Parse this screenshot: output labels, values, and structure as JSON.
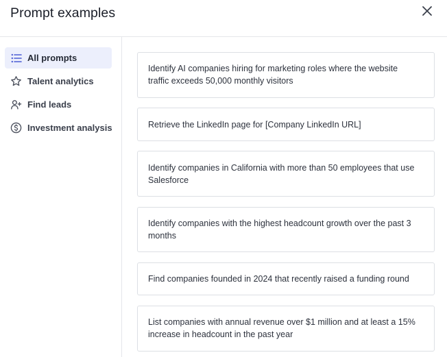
{
  "modal": {
    "title": "Prompt examples",
    "close_icon": "close-icon"
  },
  "sidebar": {
    "items": [
      {
        "label": "All prompts",
        "icon": "list-icon",
        "active": true
      },
      {
        "label": "Talent analytics",
        "icon": "star-icon",
        "active": false
      },
      {
        "label": "Find leads",
        "icon": "user-plus-icon",
        "active": false
      },
      {
        "label": "Investment analysis",
        "icon": "dollar-circle-icon",
        "active": false
      }
    ]
  },
  "prompts": [
    {
      "text": "Identify AI companies hiring for marketing roles where the website traffic exceeds 50,000 monthly visitors"
    },
    {
      "text": "Retrieve the LinkedIn page for [Company LinkedIn URL]"
    },
    {
      "text": "Identify companies in California with more than 50 employees that use Salesforce"
    },
    {
      "text": "Identify companies with the highest headcount growth over the past 3 months"
    },
    {
      "text": "Find companies founded in 2024 that recently raised a funding round"
    },
    {
      "text": "List companies with annual revenue over $1 million and at least a 15% increase in headcount in the past year"
    }
  ],
  "colors": {
    "accent": "#4a5bd4",
    "active_bg": "#eceffc",
    "border": "#dcdfe4"
  }
}
